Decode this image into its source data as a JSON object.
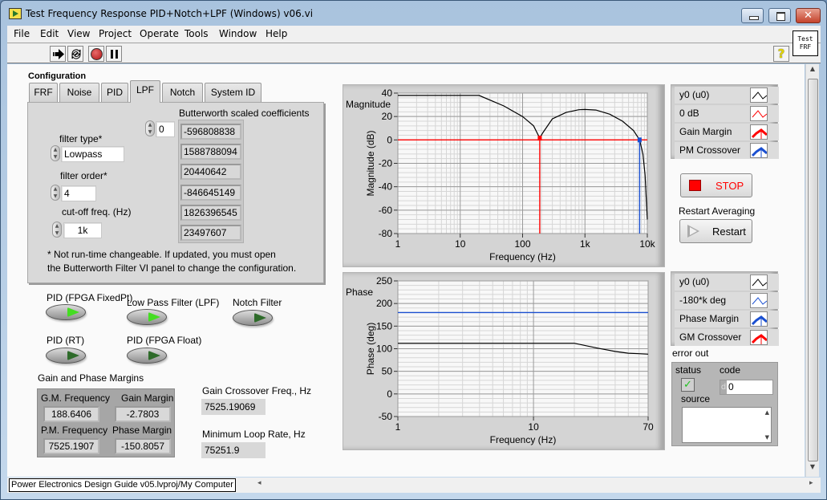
{
  "window": {
    "title": "Test Frequency Response PID+Notch+LPF (Windows) v06.vi",
    "close_glyph": "✕",
    "vi_icon_line1": "Test",
    "vi_icon_line2": "FRF"
  },
  "menu": [
    "File",
    "Edit",
    "View",
    "Project",
    "Operate",
    "Tools",
    "Window",
    "Help"
  ],
  "toolbar": {
    "help_glyph": "?"
  },
  "configuration": {
    "label": "Configuration",
    "tabs": [
      "FRF",
      "Noise",
      "PID",
      "LPF",
      "Notch",
      "System ID"
    ],
    "active_tab": "LPF",
    "filter_type_label": "filter type*",
    "filter_type_value": "Lowpass",
    "filter_order_label": "filter order*",
    "filter_order_value": "4",
    "cutoff_label": "cut-off freq. (Hz)",
    "cutoff_value": "1k",
    "coef_title": "Butterworth scaled coefficients",
    "coef_index": "0",
    "coefficients": [
      "-596808838",
      "1588788094",
      "20440642",
      "-846645149",
      "1826396545",
      "23497607"
    ],
    "note_line1": "* Not run-time changeable. If updated, you must open",
    "note_line2": "the Butterworth Filter VI panel to change the configuration."
  },
  "leds": [
    {
      "label": "PID (FPGA FixedPt)",
      "on": true
    },
    {
      "label": "Low Pass Filter (LPF)",
      "on": true
    },
    {
      "label": "Notch Filter",
      "on": false
    },
    {
      "label": "PID (RT)",
      "on": false
    },
    {
      "label": "PID (FPGA Float)",
      "on": false
    }
  ],
  "led_colors": {
    "on": "#44dd22",
    "off": "#2e6b2a"
  },
  "margins": {
    "title": "Gain and Phase Margins",
    "gm_freq_label": "G.M. Frequency",
    "gm_freq": "188.6406",
    "gain_margin_label": "Gain Margin",
    "gain_margin": "-2.7803",
    "pm_freq_label": "P.M. Frequency",
    "pm_freq": "7525.1907",
    "phase_margin_label": "Phase Margin",
    "phase_margin": "-150.8057",
    "gain_crossover_label": "Gain Crossover Freq., Hz",
    "gain_crossover": "7525.19069",
    "min_loop_rate_label": "Minimum Loop Rate, Hz",
    "min_loop_rate": "75251.9"
  },
  "magnitude_legend": [
    {
      "label": "y0 (u0)",
      "color": "#000000",
      "style": "thin"
    },
    {
      "label": "0 dB",
      "color": "#ff0000",
      "style": "thin"
    },
    {
      "label": "Gain Margin",
      "color": "#ff0000",
      "style": "thick"
    },
    {
      "label": "PM Crossover",
      "color": "#1a4fd0",
      "style": "thick"
    }
  ],
  "phase_legend": [
    {
      "label": "y0 (u0)",
      "color": "#000000",
      "style": "thin"
    },
    {
      "label": "-180*k deg",
      "color": "#1a4fd0",
      "style": "thin"
    },
    {
      "label": "Phase Margin",
      "color": "#1a4fd0",
      "style": "thick"
    },
    {
      "label": "GM Crossover",
      "color": "#ff0000",
      "style": "thick"
    }
  ],
  "buttons": {
    "stop_label": "STOP",
    "restart_caption": "Restart Averaging",
    "restart_label": "Restart"
  },
  "error_out": {
    "title": "error out",
    "status_label": "status",
    "code_label": "code",
    "code_radix": "d",
    "code_value": "0",
    "source_label": "source",
    "source_value": "",
    "status_ok": true
  },
  "statusbar": {
    "path": "Power Electronics Design Guide v05.lvproj/My Computer"
  },
  "chart_data": [
    {
      "type": "line",
      "title": "Magnitude",
      "xlabel": "Frequency (Hz)",
      "ylabel": "Magnitude (dB)",
      "xscale": "log",
      "xlim": [
        1,
        10000
      ],
      "ylim": [
        -80,
        40
      ],
      "xticks": [
        1,
        10,
        100,
        1000,
        10000
      ],
      "xtick_labels": [
        "1",
        "10",
        "100",
        "1k",
        "10k"
      ],
      "yticks": [
        40,
        20,
        0,
        -20,
        -40,
        -60,
        -80
      ],
      "grid": true,
      "series": [
        {
          "name": "y0 (u0)",
          "color": "#000000",
          "x": [
            1,
            20,
            50,
            100,
            150,
            188.6,
            210,
            300,
            500,
            800,
            1000,
            1500,
            2500,
            4000,
            6000,
            7525,
            8500,
            9200,
            9700,
            10000
          ],
          "y": [
            38,
            38,
            29,
            20,
            12,
            1.5,
            6,
            18,
            23.5,
            25.8,
            26,
            25.5,
            22,
            16,
            8,
            0,
            -12,
            -30,
            -55,
            -68
          ]
        },
        {
          "name": "0 dB",
          "color": "#ff0000",
          "x": [
            1,
            10000
          ],
          "y": [
            0,
            0
          ]
        },
        {
          "name": "Gain Margin",
          "color": "#ff0000",
          "x": [
            188.6406,
            188.6406
          ],
          "y": [
            -80,
            1.5
          ]
        },
        {
          "name": "PM Crossover",
          "color": "#1a4fd0",
          "x": [
            7525.19,
            7525.19
          ],
          "y": [
            -80,
            0
          ]
        }
      ],
      "markers": [
        {
          "x": 188.6406,
          "y": 1.5,
          "color": "#ff0000"
        },
        {
          "x": 7525.19,
          "y": 0,
          "color": "#1a4fd0"
        }
      ]
    },
    {
      "type": "line",
      "title": "Phase",
      "xlabel": "Frequency (Hz)",
      "ylabel": "Phase (deg)",
      "xscale": "log",
      "xlim": [
        1,
        70
      ],
      "ylim": [
        -50,
        250
      ],
      "xticks": [
        1,
        10,
        70
      ],
      "xtick_labels": [
        "1",
        "10",
        "70"
      ],
      "yticks": [
        250,
        200,
        150,
        100,
        50,
        0,
        -50
      ],
      "grid": true,
      "series": [
        {
          "name": "y0 (u0)",
          "color": "#000000",
          "x": [
            1,
            10,
            20,
            30,
            40,
            50,
            60,
            70
          ],
          "y": [
            112,
            112,
            112,
            101,
            94,
            90,
            89,
            88
          ]
        },
        {
          "name": "-180*k deg",
          "color": "#1a4fd0",
          "x": [
            1,
            70
          ],
          "y": [
            180,
            180
          ]
        }
      ]
    }
  ]
}
